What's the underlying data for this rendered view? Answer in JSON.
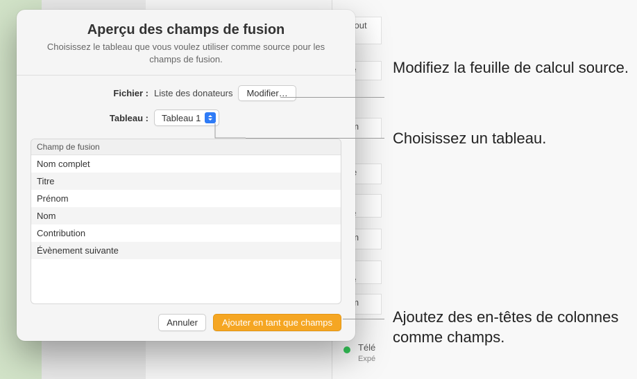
{
  "dialog": {
    "title": "Aperçu des champs de fusion",
    "subtitle": "Choisissez le tableau que vous voulez utiliser comme source pour les champs de fusion.",
    "file_label": "Fichier :",
    "file_value": "Liste des donateurs",
    "modify_button": "Modifier…",
    "table_label": "Tableau :",
    "table_value": "Tableau 1",
    "column_header": "Champ de fusion",
    "rows": [
      "Nom complet",
      "Titre",
      "Prénom",
      "Nom",
      "Contribution",
      "Évènement suivante"
    ],
    "cancel": "Annuler",
    "add": "Ajouter en tant que champs"
  },
  "callouts": {
    "c1": "Modifiez la feuille de calcul source.",
    "c2": "Choisissez un tableau.",
    "c3": "Ajoutez des en-têtes de colonnes comme champs."
  },
  "bg": {
    "tele": "Télé",
    "expe": "Expé"
  }
}
